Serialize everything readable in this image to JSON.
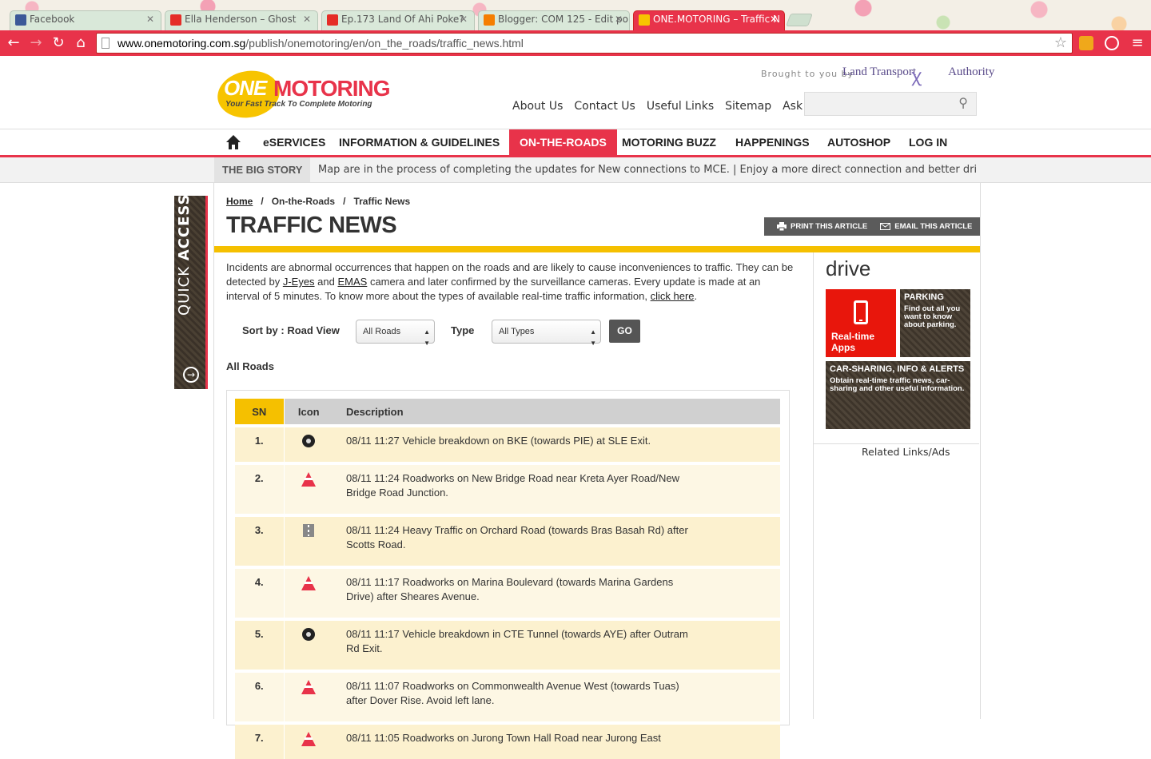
{
  "browser": {
    "tabs": [
      {
        "title": "Facebook",
        "active": false
      },
      {
        "title": "Ella Henderson – Ghost",
        "active": false
      },
      {
        "title": "Ep.173 Land Of Ahi Poke?",
        "active": false
      },
      {
        "title": "Blogger: COM 125 - Edit po",
        "active": false
      },
      {
        "title": "ONE.MOTORING – Traffic N",
        "active": true
      }
    ],
    "url_host": "www.onemotoring.com.sg",
    "url_path": "/publish/onemotoring/en/on_the_roads/traffic_news.html",
    "colors": {
      "accent": "#e8334a"
    }
  },
  "header": {
    "logo_one": "ONE",
    "logo_motoring": "MOTORING",
    "logo_tagline": "Your Fast Track To Complete Motoring",
    "brought_by": "Brought to you by",
    "lta": "Land Transport",
    "lta_tail": "Authority",
    "top_links": [
      "About Us",
      "Contact Us",
      "Useful Links",
      "Sitemap",
      "Ask LTA"
    ],
    "search_placeholder": ""
  },
  "nav": {
    "items": [
      "eSERVICES",
      "INFORMATION & GUIDELINES",
      "ON-THE-ROADS",
      "MOTORING BUZZ",
      "HAPPENINGS",
      "AUTOSHOP",
      "LOG IN"
    ],
    "active": "ON-THE-ROADS"
  },
  "bigstory": {
    "label": "THE BIG STORY",
    "ticker": "Map are in the process of completing the updates for New connections to MCE.   |   Enjoy a more direct connection and better driving experience"
  },
  "quick_access": {
    "light": "QUICK",
    "bold": "ACCESS"
  },
  "breadcrumb": {
    "home": "Home",
    "sep": "/",
    "level1": "On-the-Roads",
    "level2": "Traffic News"
  },
  "page": {
    "title": "TRAFFIC NEWS",
    "print": "PRINT THIS ARTICLE",
    "email": "EMAIL THIS ARTICLE",
    "intro_1": "Incidents are abnormal occurrences that happen on the roads and are likely to cause inconveniences to traffic. They can be detected by ",
    "intro_jeyes": "J-Eyes",
    "intro_and": " and ",
    "intro_emas": "EMAS",
    "intro_2": " camera and later confirmed by the surveillance cameras. Every update is made at an interval of 5 minutes. To know more about the types of available real-time traffic information, ",
    "intro_link": "click here",
    "intro_end": "."
  },
  "filters": {
    "sort_label": "Sort by : Road View",
    "road_value": "All Roads",
    "type_label": "Type",
    "type_value": "All Types",
    "go": "GO",
    "current": "All Roads"
  },
  "table": {
    "headers": {
      "sn": "SN",
      "icon": "Icon",
      "desc": "Description"
    },
    "rows": [
      {
        "sn": "1.",
        "icon": "breakdown-icon",
        "desc": "08/11 11:27 Vehicle breakdown on BKE (towards PIE) at SLE Exit."
      },
      {
        "sn": "2.",
        "icon": "roadworks-icon",
        "desc": "08/11 11:24 Roadworks on New Bridge Road near Kreta Ayer Road/New Bridge Road Junction."
      },
      {
        "sn": "3.",
        "icon": "heavy-traffic-icon",
        "desc": "08/11 11:24 Heavy Traffic on Orchard Road (towards Bras Basah Rd) after Scotts Road."
      },
      {
        "sn": "4.",
        "icon": "roadworks-icon",
        "desc": "08/11 11:17 Roadworks on Marina Boulevard (towards Marina Gardens Drive) after Sheares Avenue."
      },
      {
        "sn": "5.",
        "icon": "breakdown-icon",
        "desc": "08/11 11:17 Vehicle breakdown in CTE Tunnel (towards AYE) after Outram Rd Exit."
      },
      {
        "sn": "6.",
        "icon": "roadworks-icon",
        "desc": "08/11 11:07 Roadworks on Commonwealth Avenue West (towards Tuas) after Dover Rise. Avoid left lane."
      },
      {
        "sn": "7.",
        "icon": "roadworks-icon",
        "desc": "08/11 11:05 Roadworks on Jurong Town Hall Road near Jurong East"
      }
    ]
  },
  "sidebar": {
    "drive": "drive",
    "realtime": "Real-time Apps",
    "parking_head": "PARKING",
    "parking_body": "Find out all you want to know about parking.",
    "car_head": "CAR-SHARING, INFO & ALERTS",
    "car_body": "Obtain real-time traffic news, car-sharing and other useful information.",
    "related": "Related Links/Ads"
  }
}
